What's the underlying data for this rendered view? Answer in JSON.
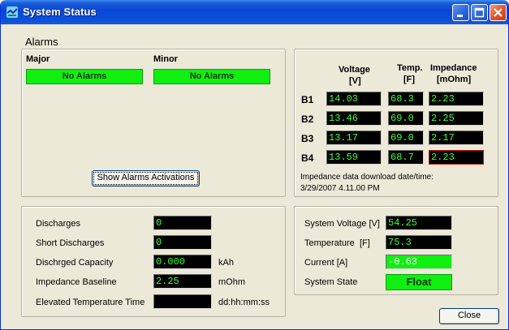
{
  "window": {
    "title": "System Status"
  },
  "alarms": {
    "heading": "Alarms",
    "major_label": "Major",
    "minor_label": "Minor",
    "major_value": "No Alarms",
    "minor_value": "No Alarms",
    "show_button": "Show Alarms Activations"
  },
  "battery_table": {
    "col_voltage": "Voltage",
    "col_voltage_unit": "[V]",
    "col_temp": "Temp.",
    "col_temp_unit": "[F]",
    "col_impedance": "Impedance",
    "col_impedance_unit": "[mOhm]",
    "rows": [
      {
        "label": "B1",
        "voltage": "14.03",
        "temp": "68.3",
        "impedance": "2.23"
      },
      {
        "label": "B2",
        "voltage": "13.46",
        "temp": "69.0",
        "impedance": "2.25"
      },
      {
        "label": "B3",
        "voltage": "13.17",
        "temp": "69.0",
        "impedance": "2.17"
      },
      {
        "label": "B4",
        "voltage": "13.59",
        "temp": "68.7",
        "impedance": "2.23"
      }
    ],
    "download_label": "Impedance data download date/time:",
    "download_value": "3/29/2007 4.11.00 PM"
  },
  "stats": {
    "discharges_label": "Discharges",
    "discharges_value": "0",
    "short_discharges_label": "Short Discharges",
    "short_discharges_value": "0",
    "capacity_label": "Dischrged Capacity",
    "capacity_value": "0.000",
    "capacity_unit": "kAh",
    "impedance_label": "Impedance Baseline",
    "impedance_value": "2.25",
    "impedance_unit": "mOhm",
    "elevated_label": "Elevated Temperature Time",
    "elevated_value": "",
    "elevated_unit": "dd:hh:mm:ss"
  },
  "system": {
    "voltage_label": "System Voltage [V]",
    "voltage_value": "54.25",
    "temperature_label": "Temperature",
    "temperature_unit": "[F]",
    "temperature_value": "75.3",
    "current_label": "Current [A]",
    "current_value": "-0.63",
    "state_label": "System State",
    "state_value": "Float"
  },
  "close_button": "Close",
  "colors": {
    "titlebar": "#0a46d6",
    "alarm_green": "#11ef11",
    "lcd_text": "#3cff3c",
    "window_bg": "#ece9d8"
  }
}
